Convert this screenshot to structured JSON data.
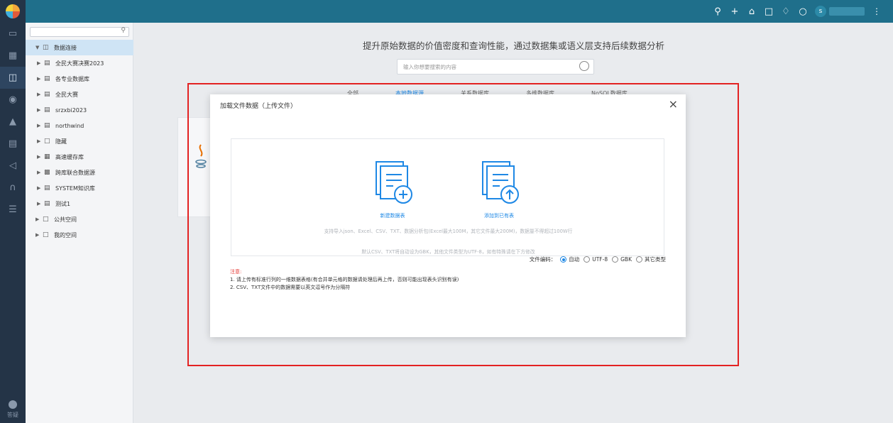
{
  "topbar": {
    "icons": [
      "search-icon",
      "plus-icon",
      "home-icon",
      "lock-icon",
      "bell-icon",
      "chat-icon"
    ],
    "user_initial": "s",
    "colors": {
      "bar": "#1f6f8b",
      "rail": "#243447"
    }
  },
  "rail": {
    "items": [
      "monitor-icon",
      "grid-icon",
      "database-icon",
      "dataset-icon",
      "analysis-icon",
      "chart-icon",
      "triangle-icon",
      "headset-icon",
      "layers-icon"
    ],
    "footer_label": "答疑"
  },
  "tree": {
    "items": [
      {
        "label": "数据连接",
        "icon": "database-icon",
        "selected": true
      },
      {
        "label": "全民大赛决赛2023",
        "icon": "db-icon"
      },
      {
        "label": "各专业数据库",
        "icon": "db-icon"
      },
      {
        "label": "全民大赛",
        "icon": "db-icon"
      },
      {
        "label": "srzxbi2023",
        "icon": "db-icon"
      },
      {
        "label": "northwind",
        "icon": "db-icon"
      },
      {
        "label": "隐藏",
        "icon": "folder-icon"
      },
      {
        "label": "高速缓存库",
        "icon": "cache-icon"
      },
      {
        "label": "跨库联合数据源",
        "icon": "federation-icon"
      },
      {
        "label": "SYSTEM知识库",
        "icon": "db-icon"
      },
      {
        "label": "测试1",
        "icon": "db-icon"
      },
      {
        "label": "公共空间",
        "icon": "folder-icon"
      },
      {
        "label": "我的空间",
        "icon": "folder-user-icon"
      }
    ]
  },
  "main": {
    "headline": "提升原始数据的价值密度和查询性能，通过数据集或语义层支持后续数据分析",
    "search_placeholder": "输入你想要搜索的内容",
    "tabs": [
      "全部",
      "本地数据源",
      "关系数据库",
      "多维数据库",
      "NoSQL数据库"
    ],
    "active_tab": "本地数据源"
  },
  "modal": {
    "title": "加载文件数据（上传文件）",
    "new_label": "新建数据表",
    "add_label": "添加到已有表",
    "hint1": "支持导入json、Excel、CSV、TXT、数据分析包(Excel最大100M，其它文件最大200M)，数据量不得超过100W行",
    "hint2": "默认CSV、TXT将自动设为GBK，其他文件类型为UTF-8，如有特殊请在下方修改",
    "encoding_label": "文件编码：",
    "encoding_options": [
      "自动",
      "UTF-8",
      "GBK",
      "其它类型"
    ],
    "encoding_selected": "自动",
    "notes_title": "注意:",
    "notes": [
      "1. 请上传有标准行列的一维数据表格(有合并单元格的数据请处理后再上传，否则可能出现表头识别有误)",
      "2. CSV、TXT文件中的数据需要以英文逗号作为分隔符"
    ],
    "accent": "#1e88e5",
    "highlight": "#e32222"
  }
}
